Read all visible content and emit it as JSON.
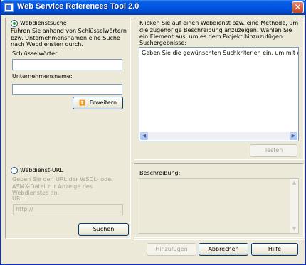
{
  "window": {
    "title": "Web Service References Tool 2.0",
    "close_glyph": "✕"
  },
  "left": {
    "search_radio_label": "Webdienstsuche",
    "search_description": "Führen Sie anhand von Schlüsselwörtern bzw. Unternehmensnamen eine Suche nach Webdiensten durch.",
    "keywords_label": "Schlüsselwörter:",
    "keywords_value": "",
    "company_label": "Unternehmensname:",
    "company_value": "",
    "expand_button": "Erweitern",
    "expand_icon": "⏬",
    "url_radio_label": "Webdienst-URL",
    "url_description": "Geben Sie den URL der WSDL- oder ASMX-Datei zur Anzeige des Webdienstes an.",
    "url_label": "URL:",
    "url_value": "http://",
    "search_button": "Suchen"
  },
  "right": {
    "instructions": "Klicken Sie auf einen Webdienst bzw. eine Methode, um die zugehörige Beschreibung anzuzeigen. Wählen Sie ein Element aus, um es dem Projekt hinzuzufügen.",
    "results_label": "Suchergebnisse:",
    "results_text": "Geben Sie die gewünschten Suchkriterien ein, um mit der Suche zu b",
    "test_button": "Testen",
    "description_label": "Beschreibung:",
    "scroll_left": "◀",
    "scroll_right": "▶",
    "scroll_up": "▲",
    "scroll_down": "▼"
  },
  "footer": {
    "add_button": "Hinzufügen",
    "cancel_button": "Abbrechen",
    "help_button": "Hilfe"
  }
}
